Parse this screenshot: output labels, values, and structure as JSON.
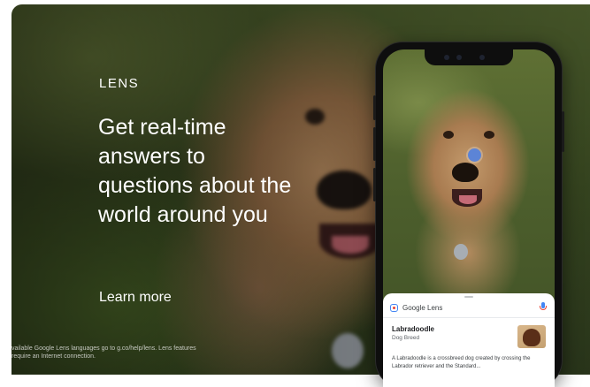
{
  "hero": {
    "eyebrow": "LENS",
    "headline": "Get real-time answers to questions about the world around you",
    "cta": "Learn more",
    "disclaimer": "vailable Google Lens languages go to g.co/help/lens. Lens features require an Internet connection."
  },
  "phone": {
    "lens_title": "Google Lens",
    "result": {
      "name": "Labradoodle",
      "type": "Dog Breed",
      "description": "A Labradoodle is a crossbreed dog created by crossing the Labrador retriever and the Standard..."
    }
  },
  "colors": {
    "lens_dot": "#5c84d6",
    "google_blue": "#4285f4",
    "google_red": "#ea4335"
  },
  "icons": [
    "google-lens-icon",
    "mic-icon",
    "lens-selection-dot-icon"
  ]
}
